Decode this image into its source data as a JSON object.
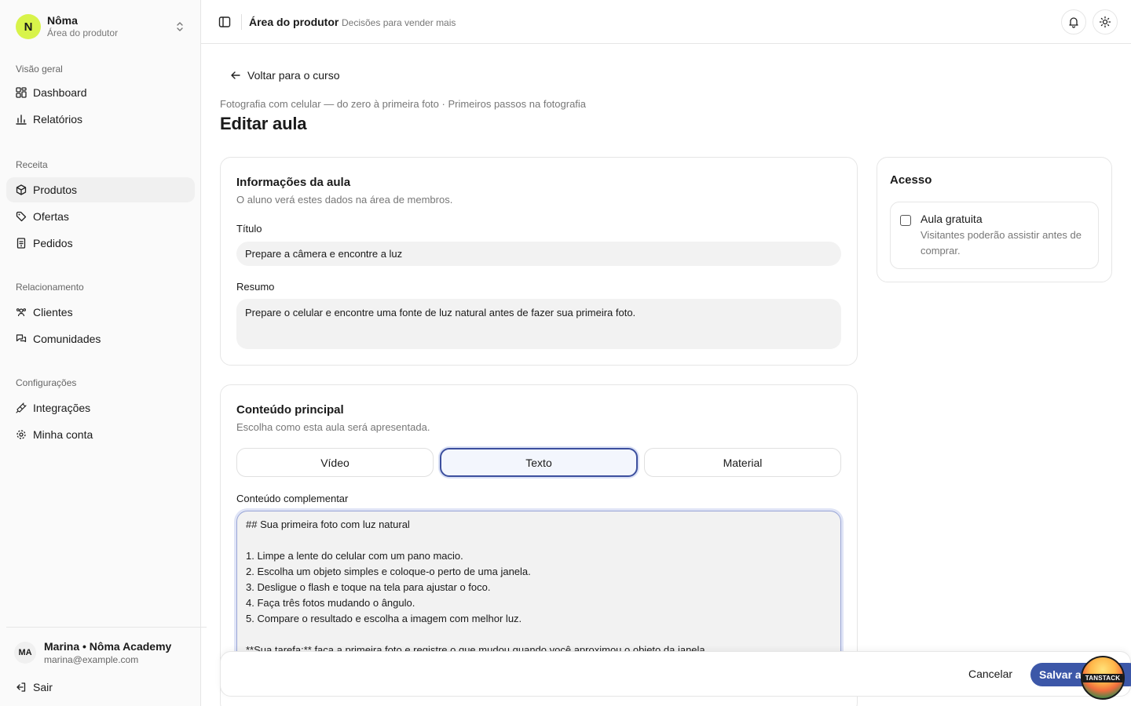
{
  "brand": {
    "initial": "N",
    "name": "Nôma",
    "subtitle": "Área do produtor"
  },
  "sidebar": {
    "sections": [
      {
        "title": "Visão geral",
        "items": [
          {
            "label": "Dashboard",
            "icon": "dashboard-icon"
          },
          {
            "label": "Relatórios",
            "icon": "chart-icon"
          }
        ]
      },
      {
        "title": "Receita",
        "items": [
          {
            "label": "Produtos",
            "icon": "box-icon",
            "active": true
          },
          {
            "label": "Ofertas",
            "icon": "tag-icon"
          },
          {
            "label": "Pedidos",
            "icon": "receipt-icon"
          }
        ]
      },
      {
        "title": "Relacionamento",
        "items": [
          {
            "label": "Clientes",
            "icon": "users-icon"
          },
          {
            "label": "Comunidades",
            "icon": "chat-icon"
          }
        ]
      },
      {
        "title": "Configurações",
        "items": [
          {
            "label": "Integrações",
            "icon": "plug-icon"
          },
          {
            "label": "Minha conta",
            "icon": "gear-icon"
          }
        ]
      }
    ]
  },
  "user": {
    "initials": "MA",
    "name": "Marina • Nôma Academy",
    "email": "marina@example.com",
    "logout_label": "Sair"
  },
  "header": {
    "title": "Área do produtor",
    "subtitle": "Decisões para vender mais"
  },
  "page": {
    "back_label": "Voltar para o curso",
    "breadcrumb": "Fotografia com celular — do zero à primeira foto · Primeiros passos na fotografia",
    "title": "Editar aula"
  },
  "info_card": {
    "title": "Informações da aula",
    "description": "O aluno verá estes dados na área de membros.",
    "title_label": "Título",
    "title_value": "Prepare a câmera e encontre a luz",
    "summary_label": "Resumo",
    "summary_value": "Prepare o celular e encontre uma fonte de luz natural antes de fazer sua primeira foto."
  },
  "content_card": {
    "title": "Conteúdo principal",
    "description": "Escolha como esta aula será apresentada.",
    "tabs": [
      {
        "label": "Vídeo"
      },
      {
        "label": "Texto",
        "active": true
      },
      {
        "label": "Material"
      }
    ],
    "editor_label": "Conteúdo complementar",
    "editor_value": "## Sua primeira foto com luz natural\n\n1. Limpe a lente do celular com um pano macio.\n2. Escolha um objeto simples e coloque-o perto de uma janela.\n3. Desligue o flash e toque na tela para ajustar o foco.\n4. Faça três fotos mudando o ângulo.\n5. Compare o resultado e escolha a imagem com melhor luz.\n\n**Sua tarefa:** faça a primeira foto e registre o que mudou quando você aproximou o objeto da janela."
  },
  "access_card": {
    "title": "Acesso",
    "option_label": "Aula gratuita",
    "option_desc": "Visitantes poderão assistir antes de comprar.",
    "checked": false
  },
  "footer": {
    "cancel_label": "Cancelar",
    "save_label": "Salvar aula"
  },
  "badge": {
    "label": "TANSTACK"
  },
  "colors": {
    "brand": "#d8f34a",
    "primary": "#3c57a8",
    "active_tab_border": "#3c4f9e"
  }
}
